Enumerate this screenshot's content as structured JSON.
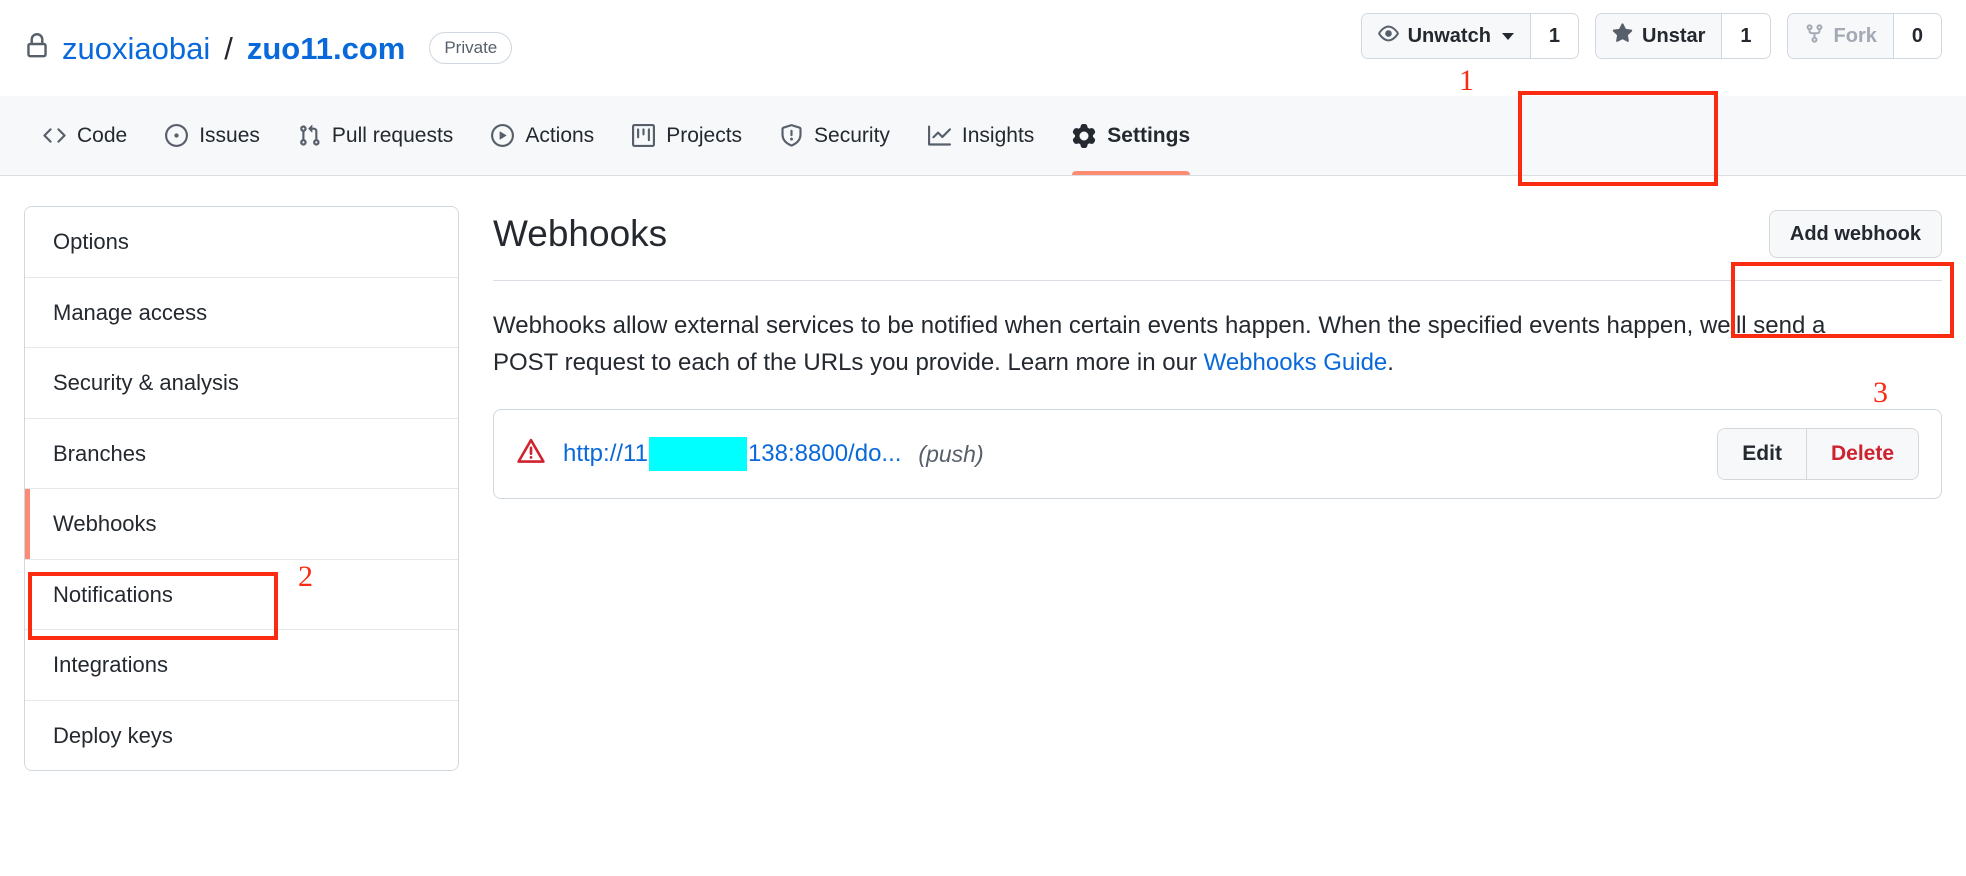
{
  "repo": {
    "lock_icon": "lock-icon",
    "owner": "zuoxiaobai",
    "separator": "/",
    "name": "zuo11.com",
    "visibility": "Private"
  },
  "header_actions": [
    {
      "icon": "eye-icon",
      "label": "Unwatch",
      "count": "1",
      "has_caret": true,
      "disabled": false
    },
    {
      "icon": "star-fill-icon",
      "label": "Unstar",
      "count": "1",
      "has_caret": false,
      "disabled": false
    },
    {
      "icon": "repo-forked-icon",
      "label": "Fork",
      "count": "0",
      "has_caret": false,
      "disabled": true
    }
  ],
  "nav": {
    "items": [
      {
        "icon": "code-icon",
        "label": "Code",
        "active": false
      },
      {
        "icon": "issue-opened-icon",
        "label": "Issues",
        "active": false
      },
      {
        "icon": "git-pull-request-icon",
        "label": "Pull requests",
        "active": false
      },
      {
        "icon": "play-icon",
        "label": "Actions",
        "active": false
      },
      {
        "icon": "project-icon",
        "label": "Projects",
        "active": false
      },
      {
        "icon": "shield-icon",
        "label": "Security",
        "active": false
      },
      {
        "icon": "graph-icon",
        "label": "Insights",
        "active": false
      },
      {
        "icon": "gear-icon",
        "label": "Settings",
        "active": true
      }
    ],
    "active_underline_color": "#fd8c73"
  },
  "sidebar": {
    "items": [
      {
        "label": "Options",
        "active": false
      },
      {
        "label": "Manage access",
        "active": false
      },
      {
        "label": "Security & analysis",
        "active": false
      },
      {
        "label": "Branches",
        "active": false
      },
      {
        "label": "Webhooks",
        "active": true
      },
      {
        "label": "Notifications",
        "active": false
      },
      {
        "label": "Integrations",
        "active": false
      },
      {
        "label": "Deploy keys",
        "active": false
      }
    ]
  },
  "main": {
    "title": "Webhooks",
    "add_button_label": "Add webhook",
    "description_part1": "Webhooks allow external services to be notified when certain events happen. When the specified events happen, we’ll send a POST request to each of the URLs you provide. Learn more in our ",
    "description_link": "Webhooks Guide",
    "description_part2": ".",
    "webhook": {
      "status_icon": "alert-triangle-icon",
      "url_prefix": "http://11",
      "url_redacted": true,
      "url_suffix": "138:8800/do...",
      "event": "(push)",
      "edit_label": "Edit",
      "delete_label": "Delete",
      "redaction_color": "#00ffff"
    }
  },
  "annotations": [
    {
      "id": "1",
      "label": "1",
      "target": "settings-tab"
    },
    {
      "id": "2",
      "label": "2",
      "target": "sidebar-item-webhooks"
    },
    {
      "id": "3",
      "label": "3",
      "target": "add-webhook-button"
    }
  ],
  "colors": {
    "link": "#0969da",
    "danger": "#cf222e",
    "accent_underline": "#fd8c73",
    "annotation_red": "#fa2b10",
    "redaction_cyan": "#00ffff"
  }
}
